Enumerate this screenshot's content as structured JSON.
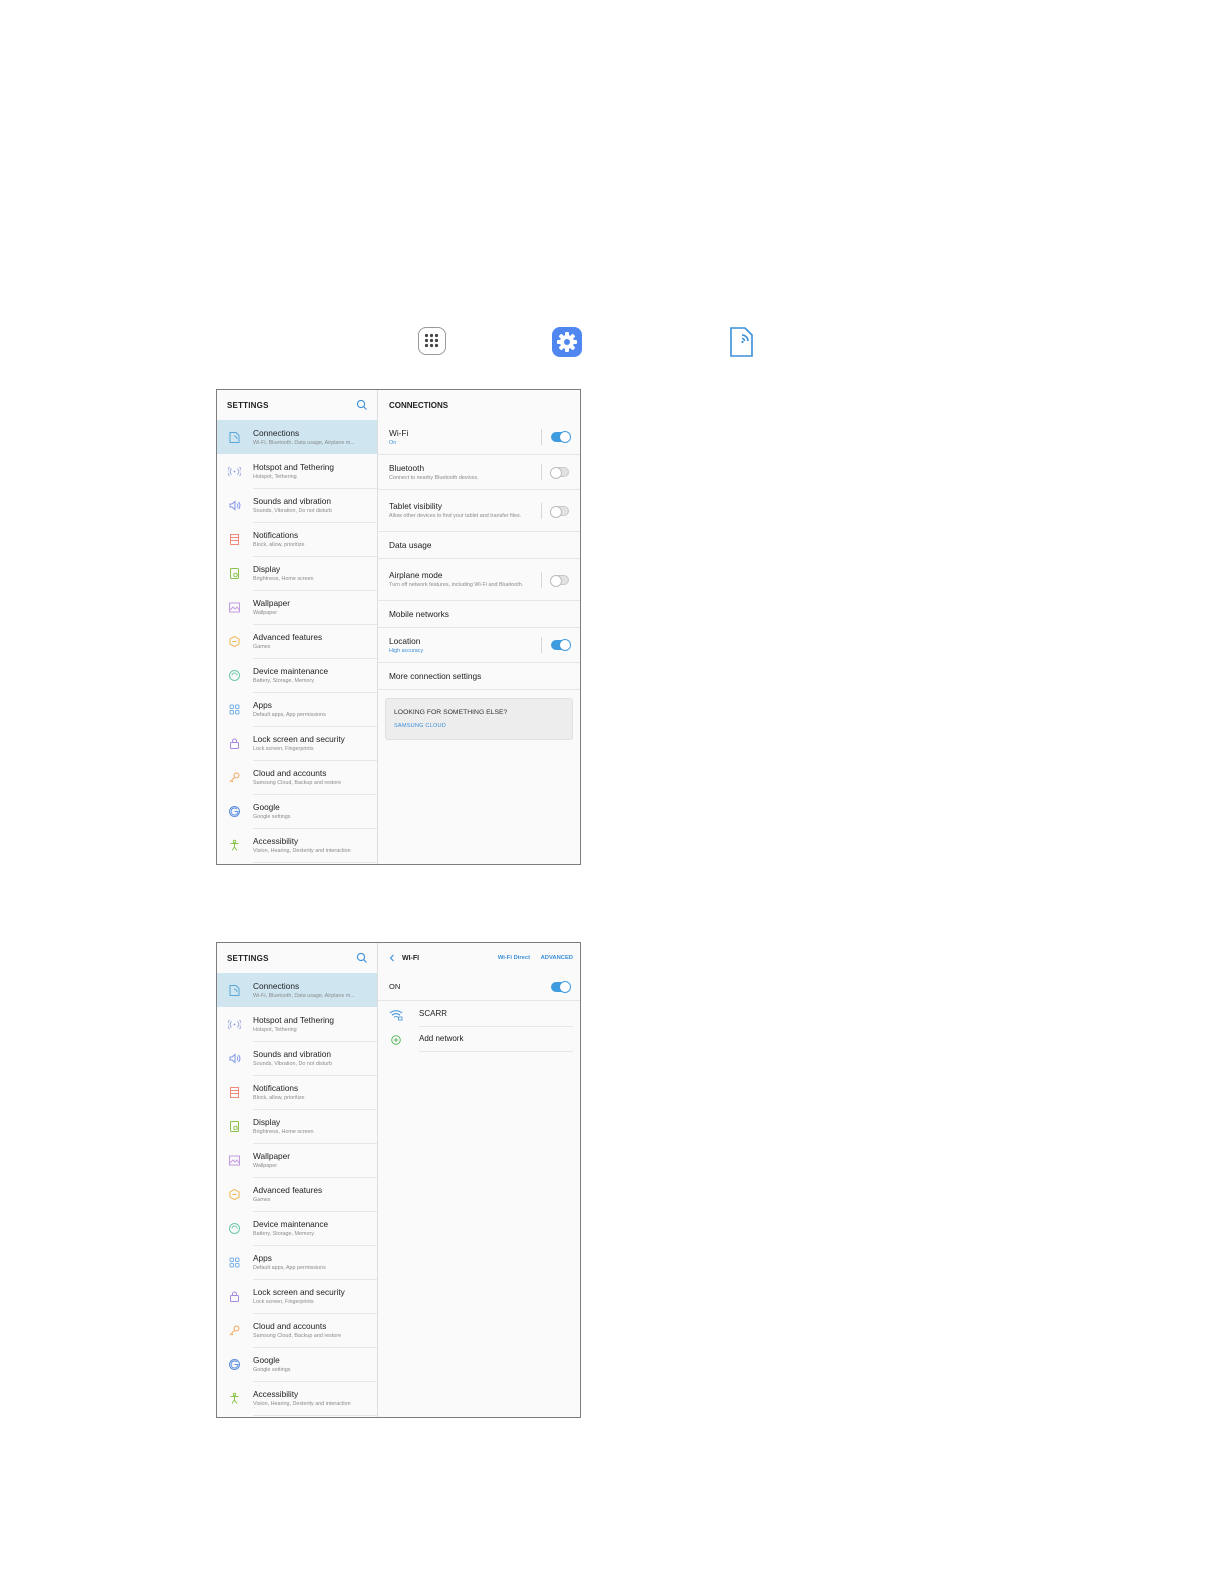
{
  "icons": {
    "apps": "apps-grid-icon",
    "settings": "settings-gear-icon",
    "connections": "connections-icon"
  },
  "colors": {
    "accent": "#3e9be0",
    "selected_bg": "#cfe6f1",
    "settings_icon_bg": "#4f86f0"
  },
  "menu": [
    {
      "title": "Connections",
      "subtitle": "Wi-Fi, Bluetooth, Data usage, Airplane m...",
      "icon": "connections-icon",
      "color": "#5aa6d8"
    },
    {
      "title": "Hotspot and Tethering",
      "subtitle": "Hotspot, Tethering",
      "icon": "hotspot-icon",
      "color": "#9aa6e0"
    },
    {
      "title": "Sounds and vibration",
      "subtitle": "Sounds, Vibration, Do not disturb",
      "icon": "speaker-icon",
      "color": "#8096e8"
    },
    {
      "title": "Notifications",
      "subtitle": "Block, allow, prioritize",
      "icon": "notifications-icon",
      "color": "#ef8a7a"
    },
    {
      "title": "Display",
      "subtitle": "Brightness, Home screen",
      "icon": "display-icon",
      "color": "#8bc34a"
    },
    {
      "title": "Wallpaper",
      "subtitle": "Wallpaper",
      "icon": "wallpaper-icon",
      "color": "#c39be0"
    },
    {
      "title": "Advanced features",
      "subtitle": "Games",
      "icon": "advanced-features-icon",
      "color": "#f2b24a"
    },
    {
      "title": "Device maintenance",
      "subtitle": "Battery, Storage, Memory",
      "icon": "device-maintenance-icon",
      "color": "#6cc7a8"
    },
    {
      "title": "Apps",
      "subtitle": "Default apps, App permissions",
      "icon": "apps-icon",
      "color": "#7ab0e8"
    },
    {
      "title": "Lock screen and security",
      "subtitle": "Lock screen, Fingerprints",
      "icon": "lock-icon",
      "color": "#a88be0"
    },
    {
      "title": "Cloud and accounts",
      "subtitle": "Samsung Cloud, Backup and restore",
      "icon": "key-icon",
      "color": "#f2a65a"
    },
    {
      "title": "Google",
      "subtitle": "Google settings",
      "icon": "google-icon",
      "color": "#5c8fe0"
    },
    {
      "title": "Accessibility",
      "subtitle": "Vision, Hearing, Dexterity and interaction",
      "icon": "accessibility-icon",
      "color": "#8bc34a"
    }
  ],
  "shot1": {
    "left_header": "SETTINGS",
    "right_header": "CONNECTIONS",
    "rows": [
      {
        "title": "Wi-Fi",
        "subtitle": "On",
        "subtitle_blue": true,
        "toggle": "on",
        "h": 34
      },
      {
        "title": "Bluetooth",
        "subtitle": "Connect to nearby Bluetooth devices.",
        "subtitle_blue": false,
        "toggle": "off",
        "h": 34
      },
      {
        "title": "Tablet visibility",
        "subtitle": "Allow other devices to find your tablet and transfer files.",
        "subtitle_blue": false,
        "toggle": "off",
        "h": 41
      },
      {
        "title": "Data usage",
        "subtitle": "",
        "subtitle_blue": false,
        "toggle": "none",
        "h": 26
      },
      {
        "title": "Airplane mode",
        "subtitle": "Turn off network features, including Wi-Fi and Bluetooth.",
        "subtitle_blue": false,
        "toggle": "off",
        "h": 41
      },
      {
        "title": "Mobile networks",
        "subtitle": "",
        "subtitle_blue": false,
        "toggle": "none",
        "h": 26
      },
      {
        "title": "Location",
        "subtitle": "High accuracy",
        "subtitle_blue": true,
        "toggle": "on",
        "h": 34
      },
      {
        "title": "More connection settings",
        "subtitle": "",
        "subtitle_blue": false,
        "toggle": "none",
        "h": 26
      }
    ],
    "card": {
      "title": "LOOKING FOR SOMETHING ELSE?",
      "link": "SAMSUNG CLOUD"
    }
  },
  "shot2": {
    "left_header": "SETTINGS",
    "wifi_title": "WI-FI",
    "wifi_direct": "Wi-Fi Direct",
    "advanced": "ADVANCED",
    "on_label": "ON",
    "networks": [
      {
        "name": "SCARR",
        "icon": "wifi-locked-icon"
      },
      {
        "name": "Add network",
        "icon": "add-network-icon"
      }
    ]
  }
}
